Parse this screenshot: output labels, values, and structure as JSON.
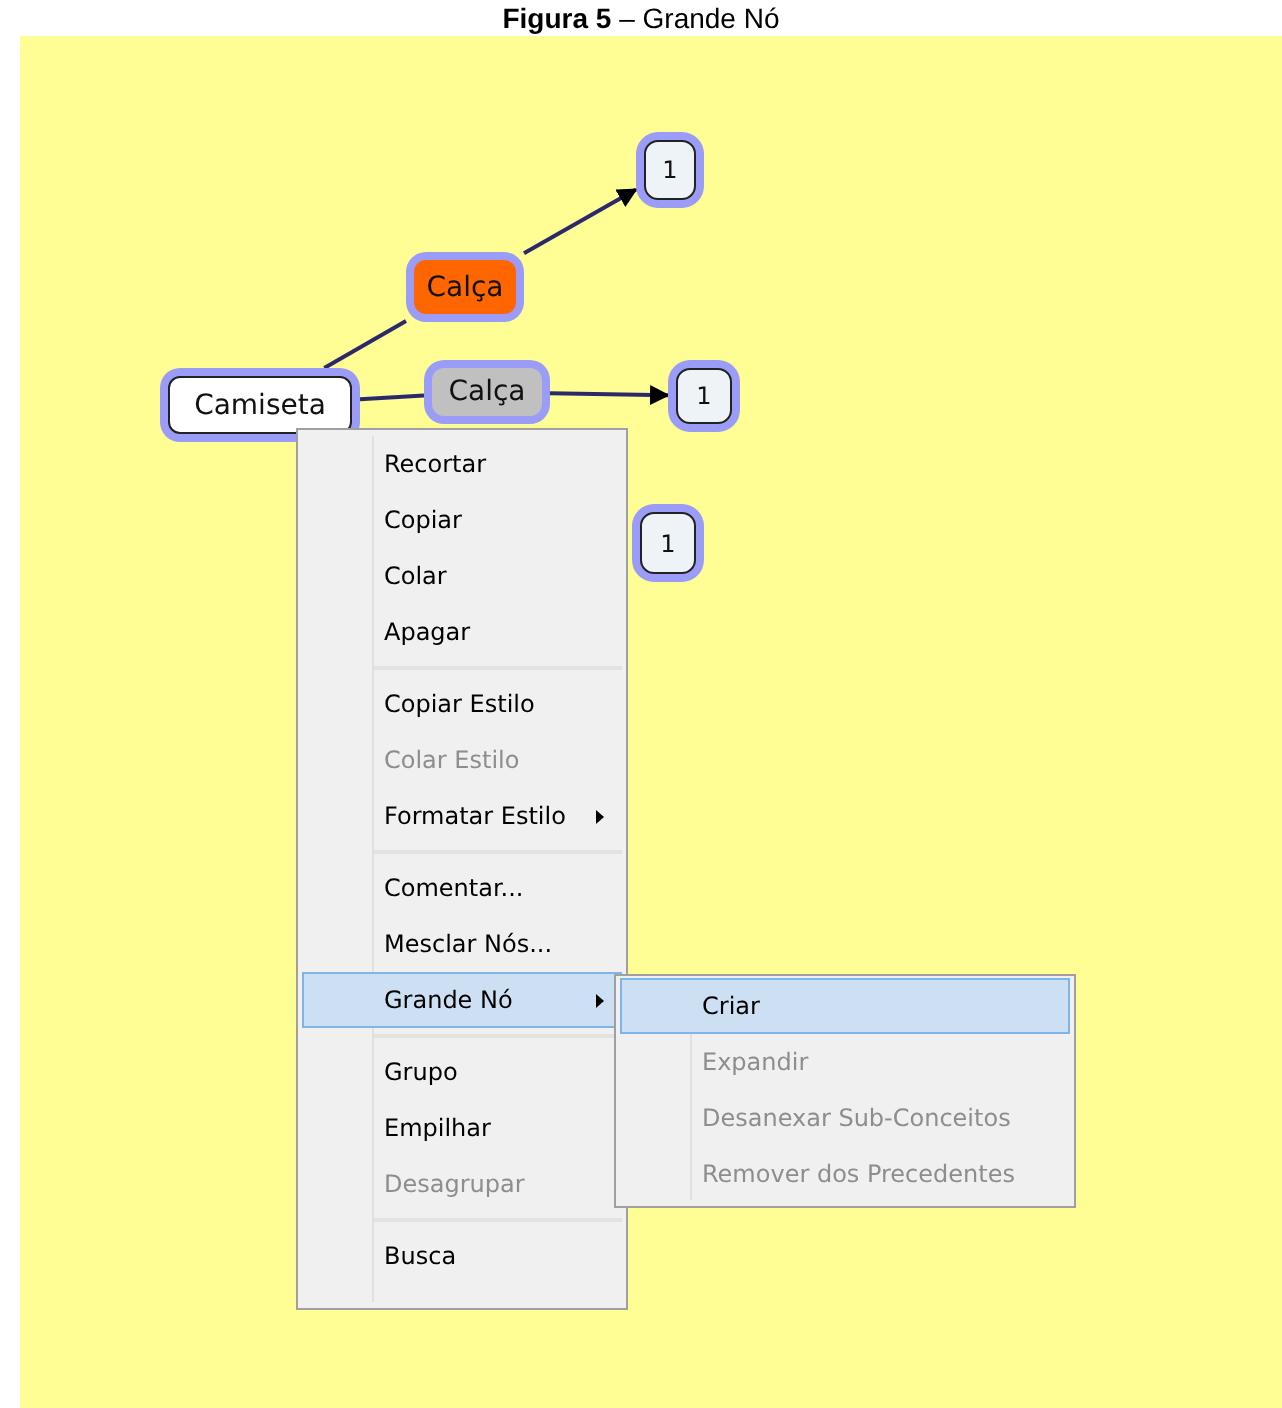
{
  "caption": "**Figura 5** – Grande Nó",
  "concept_map": {
    "nodes": [
      {
        "label": "Camiseta",
        "kind": "concept",
        "color": "#ffffff"
      },
      {
        "label": "Calça",
        "kind": "link",
        "color": "#ff6600"
      },
      {
        "label": "Calça",
        "kind": "link",
        "color": "#c0c0c0"
      },
      {
        "label": "1",
        "kind": "nested",
        "color": "#eef3f8"
      },
      {
        "label": "1",
        "kind": "nested",
        "color": "#eef3f8"
      },
      {
        "label": "1",
        "kind": "nested",
        "color": "#eef3f8"
      }
    ],
    "connections": [
      {
        "arrow": false
      },
      {
        "arrow": true
      },
      {
        "arrow": false
      },
      {
        "arrow": true
      }
    ]
  },
  "context_menu": {
    "items": [
      {
        "kind": "item",
        "label": "Recortar",
        "disabled": false,
        "selected": false,
        "submenu": false
      },
      {
        "kind": "item",
        "label": "Copiar",
        "disabled": false,
        "selected": false,
        "submenu": false
      },
      {
        "kind": "item",
        "label": "Colar",
        "disabled": false,
        "selected": false,
        "submenu": false
      },
      {
        "kind": "item",
        "label": "Apagar",
        "disabled": false,
        "selected": false,
        "submenu": false
      },
      {
        "kind": "separator"
      },
      {
        "kind": "item",
        "label": "Copiar Estilo",
        "disabled": false,
        "selected": false,
        "submenu": false
      },
      {
        "kind": "item",
        "label": "Colar Estilo",
        "disabled": true,
        "selected": false,
        "submenu": false
      },
      {
        "kind": "item",
        "label": "Formatar Estilo",
        "disabled": false,
        "selected": false,
        "submenu": true
      },
      {
        "kind": "separator"
      },
      {
        "kind": "item",
        "label": "Comentar...",
        "disabled": false,
        "selected": false,
        "submenu": false
      },
      {
        "kind": "item",
        "label": "Mesclar Nós...",
        "disabled": false,
        "selected": false,
        "submenu": false
      },
      {
        "kind": "item",
        "label": "Grande Nó",
        "disabled": false,
        "selected": true,
        "submenu": true
      },
      {
        "kind": "separator"
      },
      {
        "kind": "item",
        "label": "Grupo",
        "disabled": false,
        "selected": false,
        "submenu": false
      },
      {
        "kind": "item",
        "label": "Empilhar",
        "disabled": false,
        "selected": false,
        "submenu": false
      },
      {
        "kind": "item",
        "label": "Desagrupar",
        "disabled": true,
        "selected": false,
        "submenu": false
      },
      {
        "kind": "separator"
      },
      {
        "kind": "item",
        "label": "Busca",
        "disabled": false,
        "selected": false,
        "submenu": false
      }
    ]
  },
  "submenu": {
    "items": [
      {
        "label": "Criar",
        "disabled": false,
        "selected": true
      },
      {
        "label": "Expandir",
        "disabled": true,
        "selected": false
      },
      {
        "label": "Desanexar Sub-Conceitos",
        "disabled": true,
        "selected": false
      },
      {
        "label": "Remover dos Precedentes",
        "disabled": true,
        "selected": false
      }
    ]
  }
}
